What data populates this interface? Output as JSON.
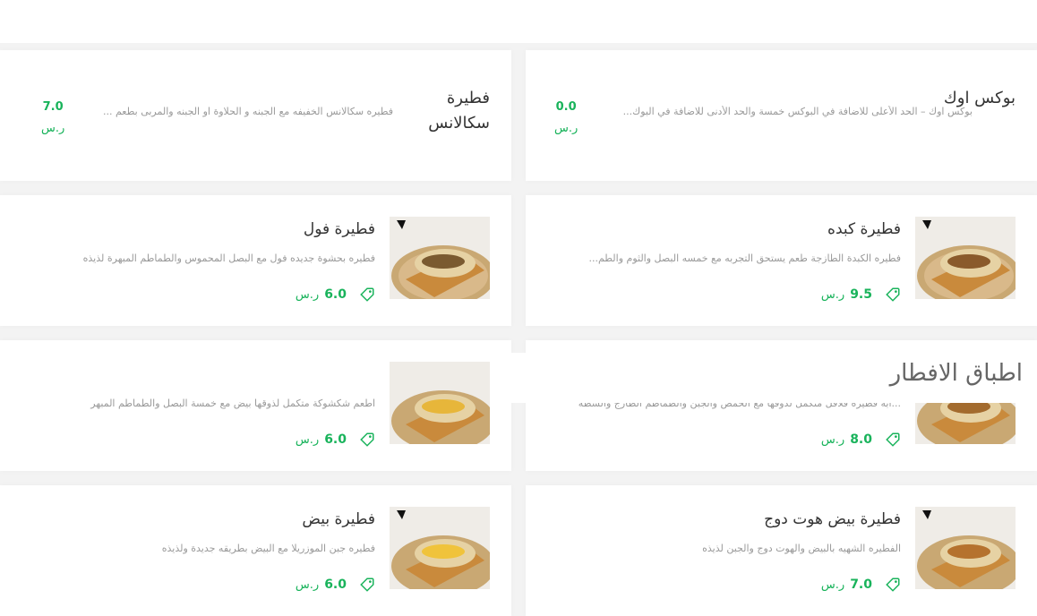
{
  "colors": {
    "accent": "#19b35b",
    "title": "#333333",
    "desc": "#999999"
  },
  "section": {
    "title": "اطباق الافطار"
  },
  "items": [
    {
      "title": "بوكس اوك",
      "desc": "بوكس اوك – الحد الأعلى للاضافة في البوكس خمسة والحد الأدنى للاضافة في البوك...",
      "price": "0.0",
      "currency": "ر.س"
    },
    {
      "title": "فطيرة سكالانس",
      "desc": "فطيره سكالانس الخفيفه مع الجبنه و الحلاوة او الجبنه والمربى بطعم ...",
      "price": "7.0",
      "currency": "ر.س"
    },
    {
      "title": "فطيرة كبده",
      "desc": "فطيره الكبدة الطازجة طعم يستحق التجربه مع خمسه البصل والثوم والطم...",
      "price": "9.5",
      "currency": "ر.س",
      "icon": "tag-icon"
    },
    {
      "title": "فطيرة فول",
      "desc": "فطيره بحشوة جديده فول مع البصل المحموس والطماطم المبهرة لذيذه",
      "price": "6.0",
      "currency": "ر.س",
      "icon": "tag-icon"
    },
    {
      "desc": "...ابه فطيرة فلافل متكمل لذوقها مع الحمص والجبن والطماطم الطازج والشطه",
      "price": "8.0",
      "currency": "ر.س",
      "icon": "tag-icon"
    },
    {
      "desc": "اطعم شكشوكة متكمل لذوقها بيض مع خمسة البصل والطماطم المبهر",
      "price": "6.0",
      "currency": "ر.س",
      "icon": "tag-icon"
    },
    {
      "title": "فطيرة بيض هوت دوج",
      "desc": "الفطيره الشهيه بالبيض والهوت دوج والجبن لذيذه",
      "price": "7.0",
      "currency": "ر.س",
      "icon": "tag-icon"
    },
    {
      "title": "فطيرة بيض",
      "desc": "فطيره جبن الموزريلا مع البيض بطريقه جديدة ولذيذه",
      "price": "6.0",
      "currency": "ر.س",
      "icon": "tag-icon"
    }
  ]
}
